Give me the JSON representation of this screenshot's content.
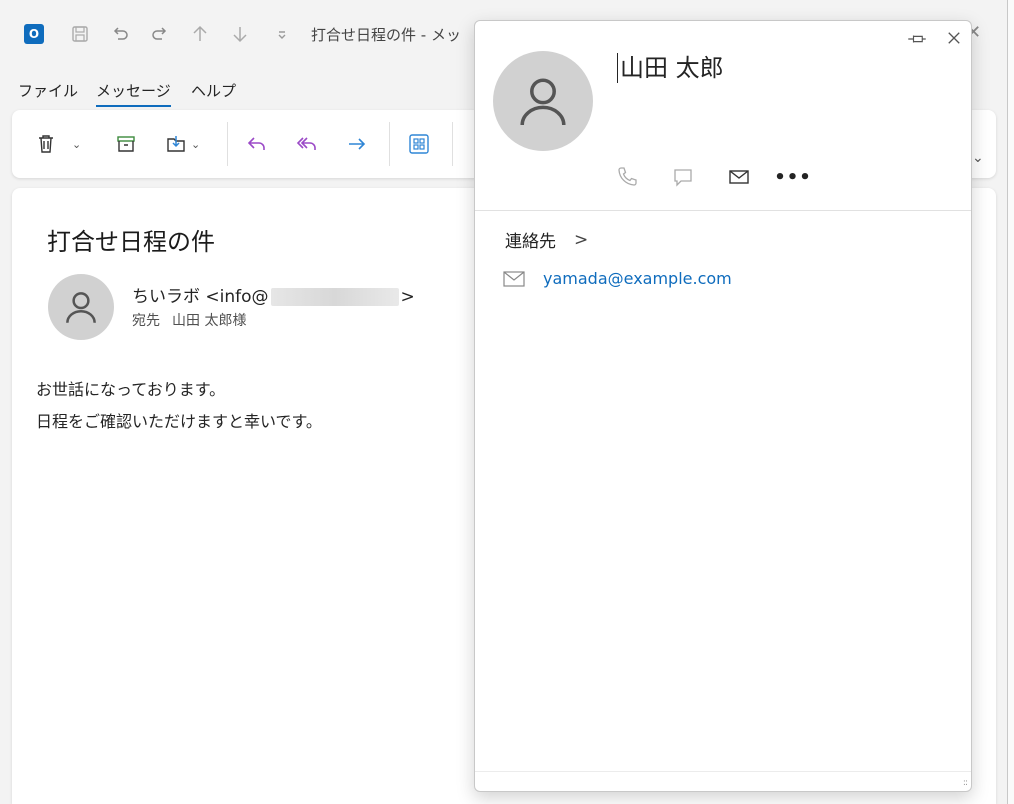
{
  "window": {
    "app_icon": "outlook-icon",
    "app_icon_letter": "O",
    "title": "打合せ日程の件 - メッ",
    "title_buttons": [
      "save-icon",
      "undo-icon",
      "redo-icon",
      "up-icon",
      "down-icon",
      "customize-icon"
    ],
    "close_glyph": "✕"
  },
  "menu": {
    "items": [
      "ファイル",
      "メッセージ",
      "ヘルプ"
    ],
    "active": "メッセージ"
  },
  "ribbon": {
    "buttons": [
      "delete-icon",
      "archive-icon",
      "move-icon",
      "reply-icon",
      "reply-all-icon",
      "forward-icon",
      "apps-icon"
    ],
    "caret": "⌄",
    "more": "⌄"
  },
  "message": {
    "subject": "打合せ日程の件",
    "sender_prefix": "ちいラボ <info@",
    "sender_suffix": ">",
    "to_label": "宛先",
    "to_name": "山田 太郎様",
    "body": [
      "お世話になっております。",
      "日程をご確認いただけますと幸いです。"
    ]
  },
  "contact_card": {
    "name": "山田 太郎",
    "actions": [
      "phone-icon",
      "chat-icon",
      "mail-icon",
      "more-icon"
    ],
    "more_label": "•••",
    "section_label": "連絡先",
    "section_chevron": ">",
    "email": "yamada@example.com",
    "grip": "::"
  },
  "colors": {
    "accent": "#0f6cbd",
    "reply_purple": "#9b4ac7",
    "forward_blue": "#2f86d6",
    "archive_green": "#3c8a3c"
  }
}
